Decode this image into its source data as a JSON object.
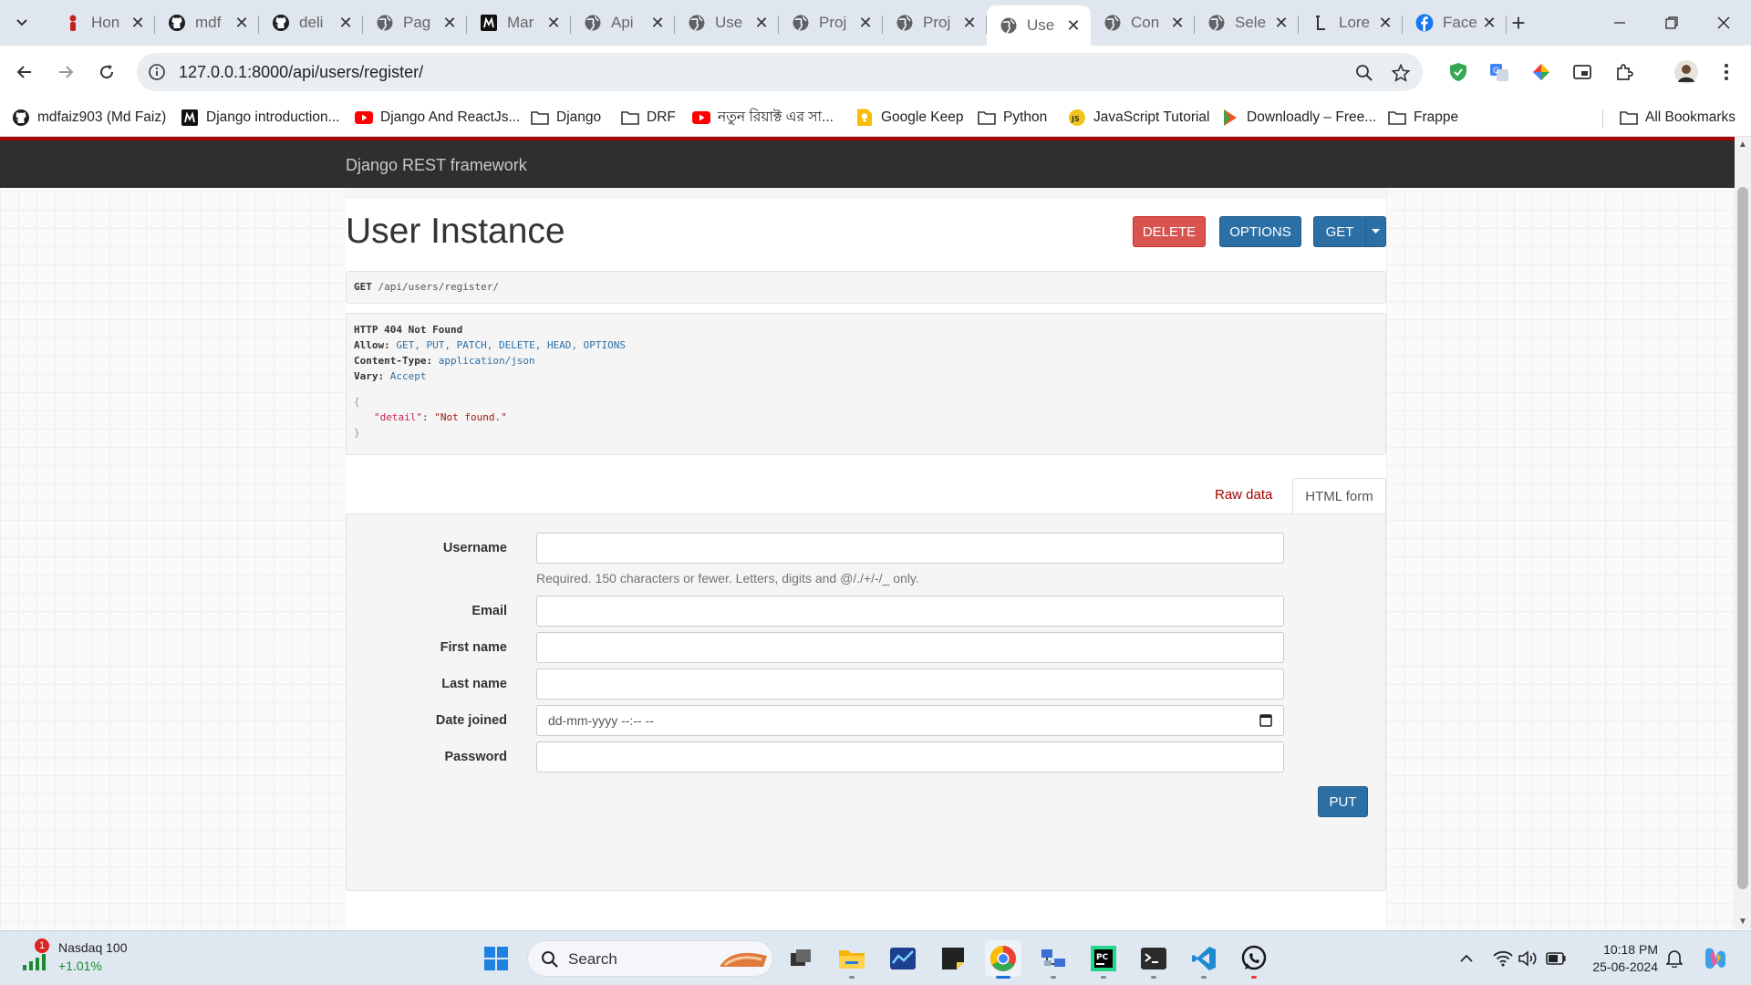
{
  "browser": {
    "tabs": [
      {
        "title": "Hon",
        "icon": "red-figure-icon",
        "active": false
      },
      {
        "title": "mdf",
        "icon": "github-icon",
        "active": false
      },
      {
        "title": "deli",
        "icon": "github-icon",
        "active": false
      },
      {
        "title": "Pag",
        "icon": "globe-icon",
        "active": false
      },
      {
        "title": "Mar",
        "icon": "m-logo-icon",
        "active": false
      },
      {
        "title": "Api",
        "icon": "globe-icon",
        "active": false
      },
      {
        "title": "Use",
        "icon": "globe-icon",
        "active": false
      },
      {
        "title": "Proj",
        "icon": "globe-icon",
        "active": false
      },
      {
        "title": "Proj",
        "icon": "globe-icon",
        "active": false
      },
      {
        "title": "Use",
        "icon": "globe-icon",
        "active": true
      },
      {
        "title": "Con",
        "icon": "globe-icon",
        "active": false
      },
      {
        "title": "Sele",
        "icon": "globe-icon",
        "active": false
      },
      {
        "title": "Lore",
        "icon": "l-logo-icon",
        "active": false
      },
      {
        "title": "Face",
        "icon": "facebook-icon",
        "active": false
      }
    ],
    "url": "127.0.0.1:8000/api/users/register/",
    "bookmarks": [
      {
        "label": "mdfaiz903 (Md Faiz)",
        "icon": "github-icon"
      },
      {
        "label": "Django introduction...",
        "icon": "m-logo-icon"
      },
      {
        "label": "Django And ReactJs...",
        "icon": "youtube-icon"
      },
      {
        "label": "Django",
        "icon": "folder-icon"
      },
      {
        "label": "DRF",
        "icon": "folder-icon"
      },
      {
        "label": "নতুন রিয়াক্ট এর সা...",
        "icon": "youtube-icon"
      },
      {
        "label": "Google Keep",
        "icon": "keep-icon"
      },
      {
        "label": "Python",
        "icon": "folder-icon"
      },
      {
        "label": "JavaScript Tutorial",
        "icon": "js-icon"
      },
      {
        "label": "Downloadly – Free...",
        "icon": "downloadly-icon"
      },
      {
        "label": "Frappe",
        "icon": "folder-icon"
      }
    ],
    "all_bookmarks": "All Bookmarks"
  },
  "drf": {
    "brand": "Django REST framework",
    "title": "User Instance",
    "buttons": {
      "delete": "DELETE",
      "options": "OPTIONS",
      "get": "GET",
      "put": "PUT"
    },
    "request": {
      "method": "GET",
      "path": "/api/users/register/"
    },
    "response": {
      "status": "HTTP 404 Not Found",
      "allow_label": "Allow:",
      "allow": "GET, PUT, PATCH, DELETE, HEAD, OPTIONS",
      "content_type_label": "Content-Type:",
      "content_type": "application/json",
      "vary_label": "Vary:",
      "vary": "Accept",
      "open_brace": "{",
      "json_key": "\"detail\"",
      "json_sep": ": ",
      "json_value": "\"Not found.\"",
      "close_brace": "}"
    },
    "form_tabs": {
      "raw": "Raw data",
      "html": "HTML form"
    },
    "form": {
      "username_label": "Username",
      "username_help": "Required. 150 characters or fewer. Letters, digits and @/./+/-/_ only.",
      "email_label": "Email",
      "first_name_label": "First name",
      "last_name_label": "Last name",
      "date_joined_label": "Date joined",
      "date_joined_placeholder": "dd-mm-yyyy --:-- --",
      "password_label": "Password"
    }
  },
  "taskbar": {
    "stock_name": "Nasdaq 100",
    "stock_change": "+1.01%",
    "stock_badge": "1",
    "search_label": "Search",
    "time": "10:18 PM",
    "date": "25-06-2024"
  },
  "colors": {
    "delete": "#d9534f",
    "primary": "#2c6fa5",
    "navbar": "#2f2f2f",
    "navbar_accent": "#a30000"
  }
}
